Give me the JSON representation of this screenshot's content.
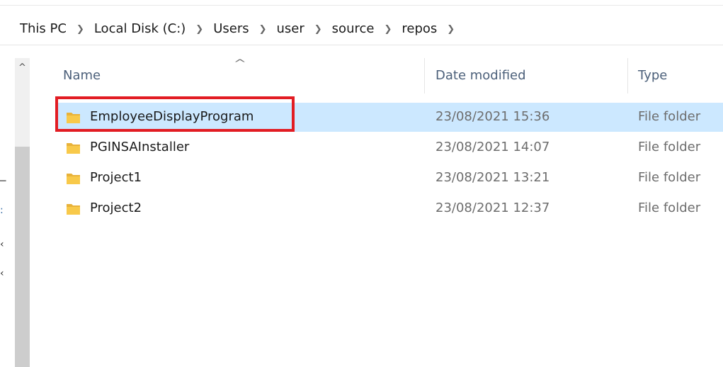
{
  "breadcrumb": {
    "items": [
      "This PC",
      "Local Disk (C:)",
      "Users",
      "user",
      "source",
      "repos"
    ]
  },
  "nav_pane": {
    "scroll_up_glyph": "^"
  },
  "columns": {
    "name": "Name",
    "date_modified": "Date modified",
    "type": "Type",
    "sort_indicator": "^"
  },
  "files": [
    {
      "name": "EmployeeDisplayProgram",
      "date_modified": "23/08/2021 15:36",
      "type": "File folder",
      "icon": "folder-icon",
      "selected": true
    },
    {
      "name": "PGINSAInstaller",
      "date_modified": "23/08/2021 14:07",
      "type": "File folder",
      "icon": "folder-icon",
      "selected": false
    },
    {
      "name": "Project1",
      "date_modified": "23/08/2021 13:21",
      "type": "File folder",
      "icon": "folder-icon",
      "selected": false
    },
    {
      "name": "Project2",
      "date_modified": "23/08/2021 12:37",
      "type": "File folder",
      "icon": "folder-icon",
      "selected": false
    }
  ],
  "colors": {
    "selection": "#cce8ff",
    "annotation_outline": "#e21c23",
    "folder": "#ffd868"
  }
}
